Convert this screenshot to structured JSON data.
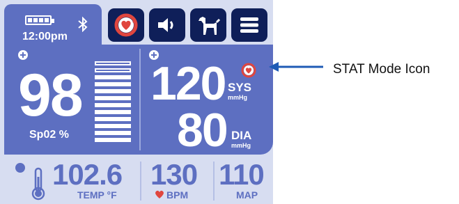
{
  "status": {
    "time": "12:00pm",
    "battery_level": 1.0
  },
  "toolbar": {
    "buttons": [
      {
        "name": "stat-mode-button",
        "icon": "stat-heart-icon"
      },
      {
        "name": "volume-button",
        "icon": "speaker-icon"
      },
      {
        "name": "dog-button",
        "icon": "dog-icon"
      },
      {
        "name": "menu-button",
        "icon": "hamburger-menu-icon"
      }
    ]
  },
  "spo2": {
    "value": "98",
    "label": "Sp02 %",
    "bar_levels": 12,
    "bars_filled": 10
  },
  "bp": {
    "systolic": "120",
    "diastolic": "80",
    "sys_label": "SYS",
    "dia_label": "DIA",
    "unit": "mmHg"
  },
  "temp": {
    "value": "102.6",
    "label": "TEMP °F"
  },
  "heart_rate": {
    "value": "130",
    "label": "BPM"
  },
  "map": {
    "value": "110",
    "label": "MAP"
  },
  "annotation": {
    "text": "STAT Mode Icon"
  },
  "colors": {
    "panel": "#5d6fc1",
    "background": "#d7ddf1",
    "button": "#0f1f59",
    "alert_red": "#e0463e"
  }
}
